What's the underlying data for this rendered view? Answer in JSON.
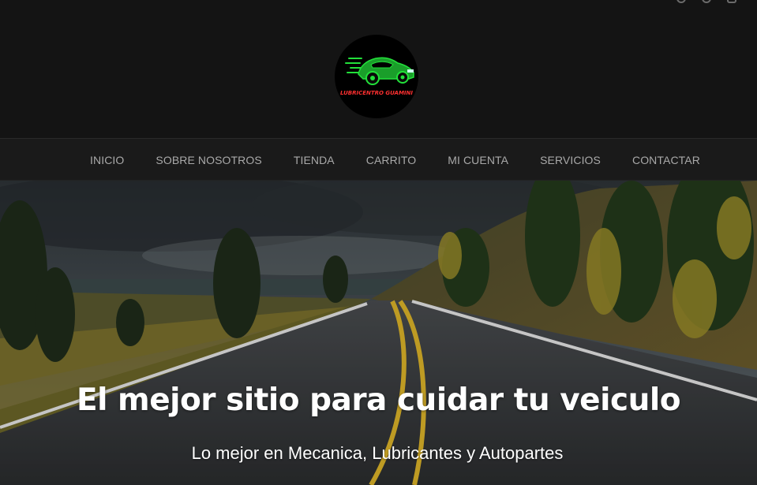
{
  "header": {
    "logo_text": "LUBRICENTRO GUAMINI",
    "social": [
      "facebook-icon",
      "twitter-icon",
      "instagram-icon"
    ]
  },
  "nav": {
    "items": [
      {
        "label": "INICIO"
      },
      {
        "label": "SOBRE NOSOTROS"
      },
      {
        "label": "TIENDA"
      },
      {
        "label": "CARRITO"
      },
      {
        "label": "MI CUENTA"
      },
      {
        "label": "SERVICIOS"
      },
      {
        "label": "CONTACTAR"
      }
    ]
  },
  "hero": {
    "title": "El mejor sitio para cuidar tu veiculo",
    "subtitle": "Lo mejor en Mecanica, Lubricantes y Autopartes"
  },
  "colors": {
    "background": "#141414",
    "logo_green": "#22e03a",
    "logo_red": "#ff3030",
    "nav_text": "#a9a9a9"
  }
}
